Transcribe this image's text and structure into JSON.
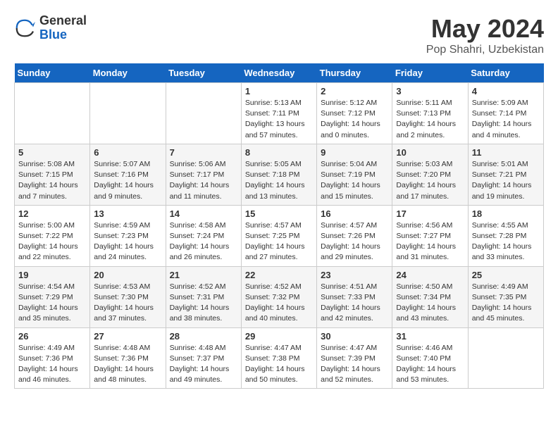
{
  "header": {
    "logo_general": "General",
    "logo_blue": "Blue",
    "month_year": "May 2024",
    "location": "Pop Shahri, Uzbekistan"
  },
  "days_of_week": [
    "Sunday",
    "Monday",
    "Tuesday",
    "Wednesday",
    "Thursday",
    "Friday",
    "Saturday"
  ],
  "weeks": [
    [
      {
        "day": "",
        "info": ""
      },
      {
        "day": "",
        "info": ""
      },
      {
        "day": "",
        "info": ""
      },
      {
        "day": "1",
        "info": "Sunrise: 5:13 AM\nSunset: 7:11 PM\nDaylight: 13 hours and 57 minutes."
      },
      {
        "day": "2",
        "info": "Sunrise: 5:12 AM\nSunset: 7:12 PM\nDaylight: 14 hours and 0 minutes."
      },
      {
        "day": "3",
        "info": "Sunrise: 5:11 AM\nSunset: 7:13 PM\nDaylight: 14 hours and 2 minutes."
      },
      {
        "day": "4",
        "info": "Sunrise: 5:09 AM\nSunset: 7:14 PM\nDaylight: 14 hours and 4 minutes."
      }
    ],
    [
      {
        "day": "5",
        "info": "Sunrise: 5:08 AM\nSunset: 7:15 PM\nDaylight: 14 hours and 7 minutes."
      },
      {
        "day": "6",
        "info": "Sunrise: 5:07 AM\nSunset: 7:16 PM\nDaylight: 14 hours and 9 minutes."
      },
      {
        "day": "7",
        "info": "Sunrise: 5:06 AM\nSunset: 7:17 PM\nDaylight: 14 hours and 11 minutes."
      },
      {
        "day": "8",
        "info": "Sunrise: 5:05 AM\nSunset: 7:18 PM\nDaylight: 14 hours and 13 minutes."
      },
      {
        "day": "9",
        "info": "Sunrise: 5:04 AM\nSunset: 7:19 PM\nDaylight: 14 hours and 15 minutes."
      },
      {
        "day": "10",
        "info": "Sunrise: 5:03 AM\nSunset: 7:20 PM\nDaylight: 14 hours and 17 minutes."
      },
      {
        "day": "11",
        "info": "Sunrise: 5:01 AM\nSunset: 7:21 PM\nDaylight: 14 hours and 19 minutes."
      }
    ],
    [
      {
        "day": "12",
        "info": "Sunrise: 5:00 AM\nSunset: 7:22 PM\nDaylight: 14 hours and 22 minutes."
      },
      {
        "day": "13",
        "info": "Sunrise: 4:59 AM\nSunset: 7:23 PM\nDaylight: 14 hours and 24 minutes."
      },
      {
        "day": "14",
        "info": "Sunrise: 4:58 AM\nSunset: 7:24 PM\nDaylight: 14 hours and 26 minutes."
      },
      {
        "day": "15",
        "info": "Sunrise: 4:57 AM\nSunset: 7:25 PM\nDaylight: 14 hours and 27 minutes."
      },
      {
        "day": "16",
        "info": "Sunrise: 4:57 AM\nSunset: 7:26 PM\nDaylight: 14 hours and 29 minutes."
      },
      {
        "day": "17",
        "info": "Sunrise: 4:56 AM\nSunset: 7:27 PM\nDaylight: 14 hours and 31 minutes."
      },
      {
        "day": "18",
        "info": "Sunrise: 4:55 AM\nSunset: 7:28 PM\nDaylight: 14 hours and 33 minutes."
      }
    ],
    [
      {
        "day": "19",
        "info": "Sunrise: 4:54 AM\nSunset: 7:29 PM\nDaylight: 14 hours and 35 minutes."
      },
      {
        "day": "20",
        "info": "Sunrise: 4:53 AM\nSunset: 7:30 PM\nDaylight: 14 hours and 37 minutes."
      },
      {
        "day": "21",
        "info": "Sunrise: 4:52 AM\nSunset: 7:31 PM\nDaylight: 14 hours and 38 minutes."
      },
      {
        "day": "22",
        "info": "Sunrise: 4:52 AM\nSunset: 7:32 PM\nDaylight: 14 hours and 40 minutes."
      },
      {
        "day": "23",
        "info": "Sunrise: 4:51 AM\nSunset: 7:33 PM\nDaylight: 14 hours and 42 minutes."
      },
      {
        "day": "24",
        "info": "Sunrise: 4:50 AM\nSunset: 7:34 PM\nDaylight: 14 hours and 43 minutes."
      },
      {
        "day": "25",
        "info": "Sunrise: 4:49 AM\nSunset: 7:35 PM\nDaylight: 14 hours and 45 minutes."
      }
    ],
    [
      {
        "day": "26",
        "info": "Sunrise: 4:49 AM\nSunset: 7:36 PM\nDaylight: 14 hours and 46 minutes."
      },
      {
        "day": "27",
        "info": "Sunrise: 4:48 AM\nSunset: 7:36 PM\nDaylight: 14 hours and 48 minutes."
      },
      {
        "day": "28",
        "info": "Sunrise: 4:48 AM\nSunset: 7:37 PM\nDaylight: 14 hours and 49 minutes."
      },
      {
        "day": "29",
        "info": "Sunrise: 4:47 AM\nSunset: 7:38 PM\nDaylight: 14 hours and 50 minutes."
      },
      {
        "day": "30",
        "info": "Sunrise: 4:47 AM\nSunset: 7:39 PM\nDaylight: 14 hours and 52 minutes."
      },
      {
        "day": "31",
        "info": "Sunrise: 4:46 AM\nSunset: 7:40 PM\nDaylight: 14 hours and 53 minutes."
      },
      {
        "day": "",
        "info": ""
      }
    ]
  ]
}
